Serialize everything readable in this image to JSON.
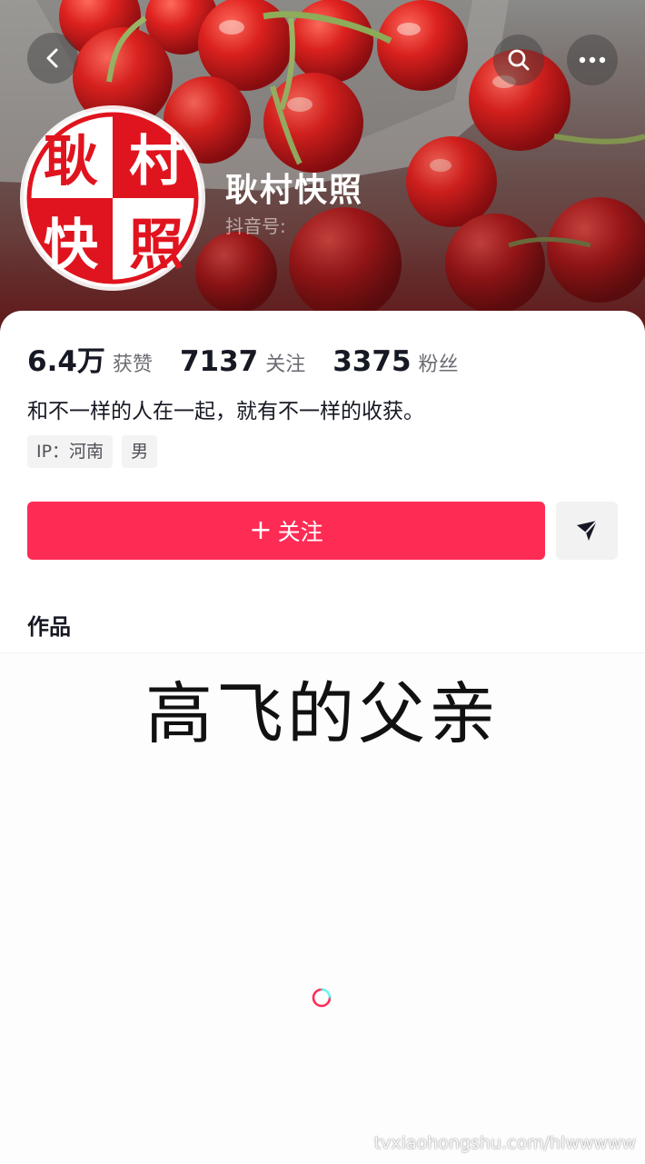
{
  "header": {
    "profile_name": "耿村快照",
    "douyin_id_label": "抖音号:",
    "avatar_text": [
      "耿",
      "村",
      "快",
      "照"
    ]
  },
  "stats": [
    {
      "value": "6.4万",
      "label": "获赞"
    },
    {
      "value": "7137",
      "label": "关注"
    },
    {
      "value": "3375",
      "label": "粉丝"
    }
  ],
  "bio": "和不一样的人在一起，就有不一样的收获。",
  "tags": [
    "IP：河南",
    "男"
  ],
  "actions": {
    "follow_plus": "+",
    "follow_label": "关注"
  },
  "works": {
    "tab_label": "作品",
    "overlay_caption": "高飞的父亲"
  },
  "watermark": "tvxiaohongshu.com/hlwwwww",
  "colors": {
    "follow_button": "#fe2c55",
    "avatar_red": "#e0141e"
  },
  "icons": {
    "back": "chevron-left-icon",
    "search": "search-icon",
    "more": "more-dots-icon",
    "share": "send-arrow-icon",
    "loading": "loading-spinner-icon"
  }
}
